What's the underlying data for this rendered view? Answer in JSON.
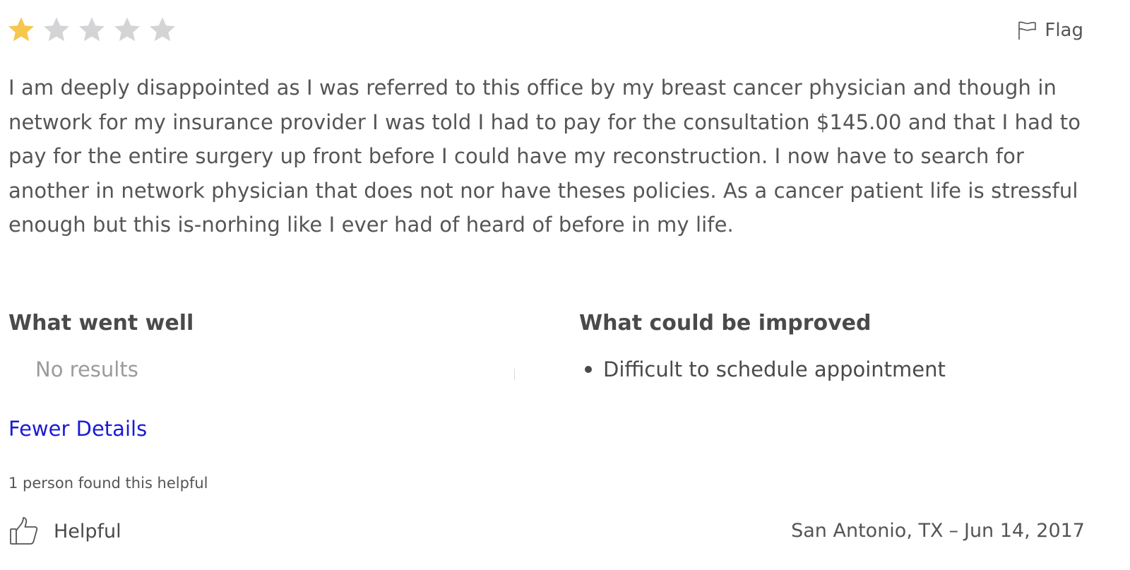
{
  "rating": {
    "value": 1,
    "max": 5,
    "filled_color": "#f5c74e",
    "empty_color": "#d4d4d6"
  },
  "flag": {
    "icon": "flag-icon",
    "label": "Flag"
  },
  "review": {
    "text": "I am deeply disappointed as I was referred to this office by my breast cancer physician and though in network for my insurance provider I was told I had to pay for the consultation $145.00 and that I had to pay for the entire surgery up front before I could have my reconstruction. I now have to search for another in network physician that does not nor have theses policies. As a cancer patient life is stressful enough but this is-norhing like I ever had of heard of before in my life."
  },
  "went_well": {
    "heading": "What went well",
    "empty_text": "No results"
  },
  "could_improve": {
    "heading": "What could be improved",
    "items": [
      "Difficult to schedule appointment"
    ]
  },
  "details_link": {
    "label": "Fewer Details",
    "color": "#1a1ad6"
  },
  "helpful": {
    "count_text": "1 person found this helpful",
    "button_label": "Helpful",
    "icon": "thumbs-up-icon"
  },
  "meta": {
    "location": "San Antonio, TX",
    "separator": "–",
    "date": "Jun 14, 2017"
  }
}
